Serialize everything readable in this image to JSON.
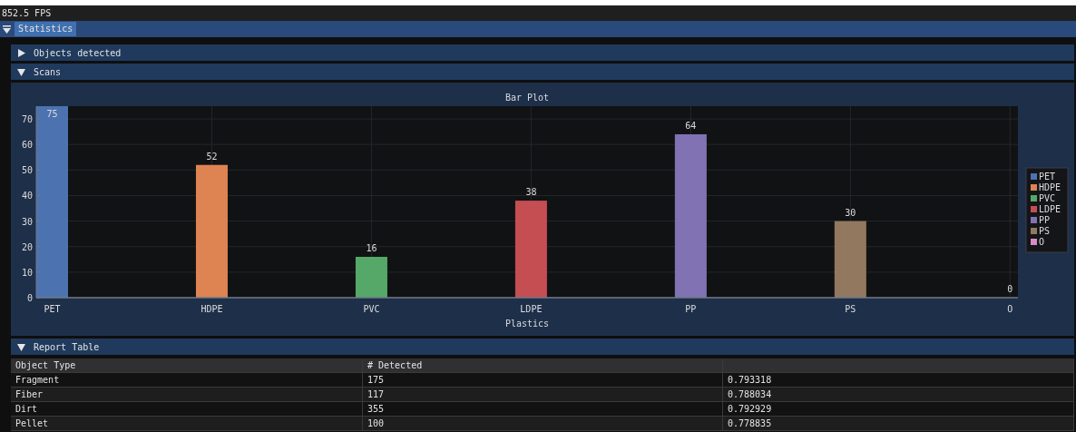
{
  "fps": "852.5 FPS",
  "window": {
    "title": "Statistics",
    "collapsed": false
  },
  "sections": [
    {
      "title": "Objects detected",
      "expanded": false
    },
    {
      "title": "Scans",
      "expanded": true,
      "chart_data": {
        "type": "bar",
        "title": "Bar Plot",
        "xlabel": "Plastics",
        "categories": [
          "PET",
          "HDPE",
          "PVC",
          "LDPE",
          "PP",
          "PS",
          "O"
        ],
        "series": [
          {
            "name": "PET",
            "color": "#4c72b0",
            "values": [
              75,
              null,
              null,
              null,
              null,
              null,
              null
            ]
          },
          {
            "name": "HDPE",
            "color": "#dd8452",
            "values": [
              null,
              52,
              null,
              null,
              null,
              null,
              null
            ]
          },
          {
            "name": "PVC",
            "color": "#55a868",
            "values": [
              null,
              null,
              16,
              null,
              null,
              null,
              null
            ]
          },
          {
            "name": "LDPE",
            "color": "#c44e52",
            "values": [
              null,
              null,
              null,
              38,
              null,
              null,
              null
            ]
          },
          {
            "name": "PP",
            "color": "#8172b3",
            "values": [
              null,
              null,
              null,
              null,
              64,
              null,
              null
            ]
          },
          {
            "name": "PS",
            "color": "#937860",
            "values": [
              null,
              null,
              null,
              null,
              null,
              30,
              null
            ]
          },
          {
            "name": "O",
            "color": "#da8bc3",
            "values": [
              null,
              null,
              null,
              null,
              null,
              null,
              0
            ]
          }
        ],
        "ylim": [
          0,
          75
        ],
        "yticks": [
          0,
          10,
          20,
          30,
          40,
          50,
          60,
          70
        ],
        "data_labels": true,
        "grid": true,
        "legend": true
      }
    },
    {
      "title": "Report Table",
      "expanded": true,
      "table": {
        "columns": [
          "Object Type",
          "# Detected"
        ],
        "rows": [
          [
            "Fragment",
            "175",
            "0.793318"
          ],
          [
            "Fiber",
            "117",
            "0.788034"
          ],
          [
            "Dirt",
            "355",
            "0.792929"
          ],
          [
            "Pellet",
            "100",
            "0.778835"
          ]
        ]
      }
    }
  ]
}
